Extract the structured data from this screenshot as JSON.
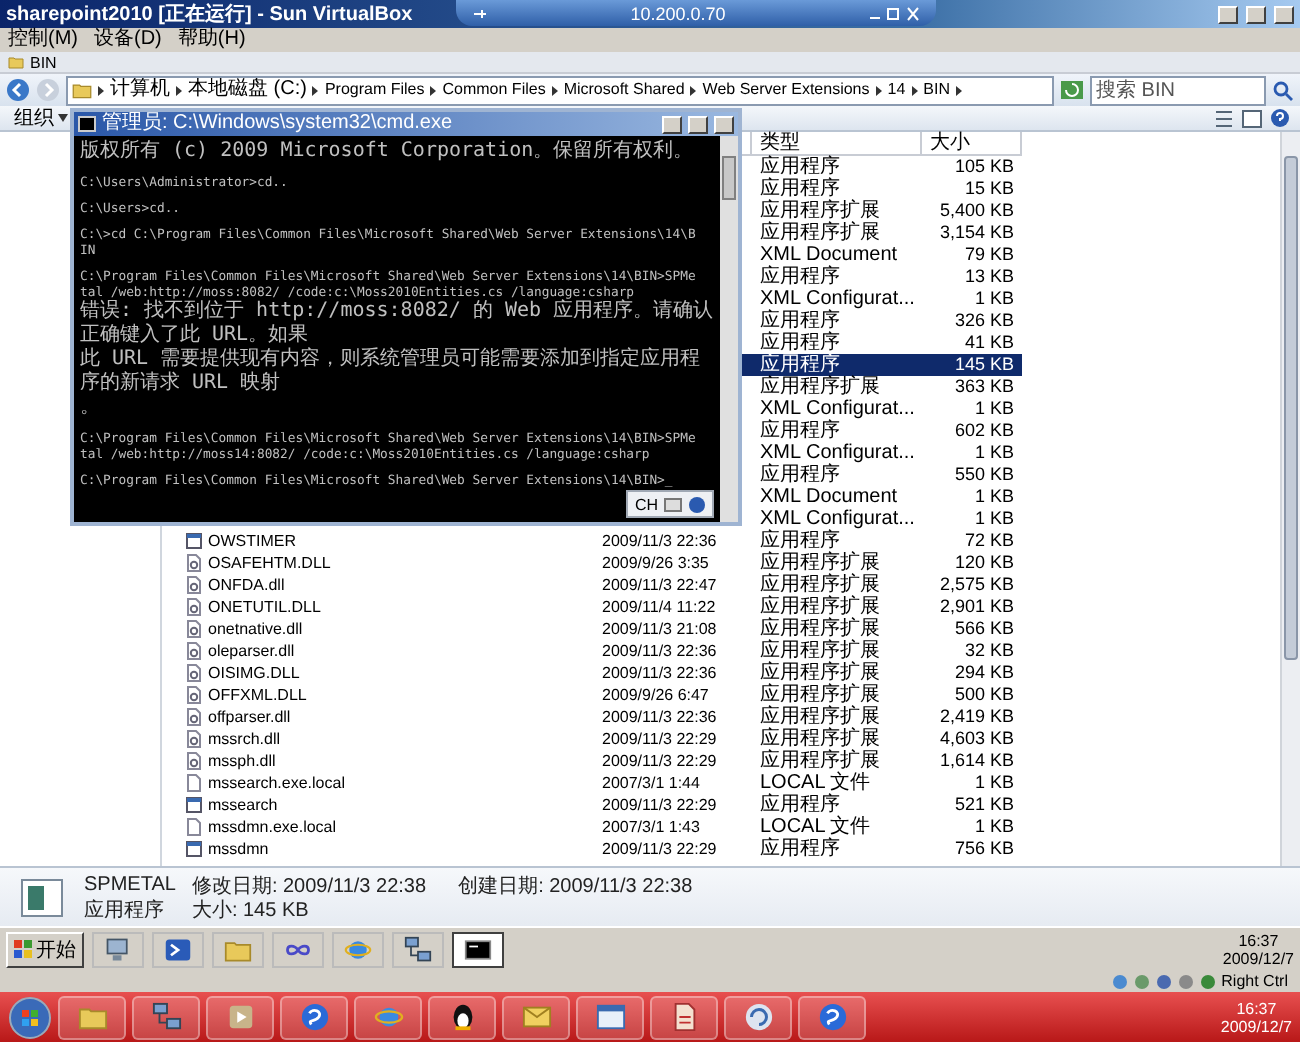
{
  "vm_window": {
    "title": "sharepoint2010 [正在运行] - Sun VirtualBox",
    "menu": [
      "控制(M)",
      "设备(D)",
      "帮助(H)"
    ]
  },
  "remote_bar": {
    "address": "10.200.0.70"
  },
  "explorer": {
    "title": "BIN",
    "breadcrumb": [
      {
        "label": "计算机",
        "kind": "system"
      },
      {
        "label": "本地磁盘 (C:)",
        "kind": "system"
      },
      {
        "label": "Program Files",
        "kind": "folder"
      },
      {
        "label": "Common Files",
        "kind": "folder"
      },
      {
        "label": "Microsoft Shared",
        "kind": "folder"
      },
      {
        "label": "Web Server Extensions",
        "kind": "folder"
      },
      {
        "label": "14",
        "kind": "folder"
      },
      {
        "label": "BIN",
        "kind": "folder"
      }
    ],
    "search": {
      "placeholder": "搜索 BIN"
    },
    "organize": "组织",
    "columns": [
      "类型",
      "大小"
    ],
    "rows": [
      {
        "type": "应用程序",
        "size": "105 KB",
        "selected": false
      },
      {
        "type": "应用程序",
        "size": "15 KB",
        "selected": false
      },
      {
        "type": "应用程序扩展",
        "size": "5,400 KB",
        "selected": false
      },
      {
        "type": "应用程序扩展",
        "size": "3,154 KB",
        "selected": false
      },
      {
        "type": "XML Document",
        "size": "79 KB",
        "selected": false
      },
      {
        "type": "应用程序",
        "size": "13 KB",
        "selected": false
      },
      {
        "type": "XML Configurat...",
        "size": "1 KB",
        "selected": false
      },
      {
        "type": "应用程序",
        "size": "326 KB",
        "selected": false
      },
      {
        "type": "应用程序",
        "size": "41 KB",
        "selected": false
      },
      {
        "type": "应用程序",
        "size": "145 KB",
        "selected": true
      },
      {
        "type": "应用程序扩展",
        "size": "363 KB",
        "selected": false
      },
      {
        "type": "XML Configurat...",
        "size": "1 KB",
        "selected": false
      },
      {
        "type": "应用程序",
        "size": "602 KB",
        "selected": false
      },
      {
        "type": "XML Configurat...",
        "size": "1 KB",
        "selected": false
      },
      {
        "type": "应用程序",
        "size": "550 KB",
        "selected": false
      },
      {
        "type": "XML Document",
        "size": "1 KB",
        "selected": false
      },
      {
        "type": "XML Configurat...",
        "size": "1 KB",
        "selected": false
      },
      {
        "name": "OWSTIMER",
        "kind": "exe",
        "date": "2009/11/3 22:36",
        "type": "应用程序",
        "size": "72 KB",
        "selected": false
      },
      {
        "name": "OSAFEHTM.DLL",
        "kind": "dll",
        "date": "2009/9/26 3:35",
        "type": "应用程序扩展",
        "size": "120 KB",
        "selected": false
      },
      {
        "name": "ONFDA.dll",
        "kind": "dll",
        "date": "2009/11/3 22:47",
        "type": "应用程序扩展",
        "size": "2,575 KB",
        "selected": false
      },
      {
        "name": "ONETUTIL.DLL",
        "kind": "dll",
        "date": "2009/11/4 11:22",
        "type": "应用程序扩展",
        "size": "2,901 KB",
        "selected": false
      },
      {
        "name": "onetnative.dll",
        "kind": "dll",
        "date": "2009/11/3 21:08",
        "type": "应用程序扩展",
        "size": "566 KB",
        "selected": false
      },
      {
        "name": "oleparser.dll",
        "kind": "dll",
        "date": "2009/11/3 22:36",
        "type": "应用程序扩展",
        "size": "32 KB",
        "selected": false
      },
      {
        "name": "OISIMG.DLL",
        "kind": "dll",
        "date": "2009/11/3 22:36",
        "type": "应用程序扩展",
        "size": "294 KB",
        "selected": false
      },
      {
        "name": "OFFXML.DLL",
        "kind": "dll",
        "date": "2009/9/26 6:47",
        "type": "应用程序扩展",
        "size": "500 KB",
        "selected": false
      },
      {
        "name": "offparser.dll",
        "kind": "dll",
        "date": "2009/11/3 22:36",
        "type": "应用程序扩展",
        "size": "2,419 KB",
        "selected": false
      },
      {
        "name": "mssrch.dll",
        "kind": "dll",
        "date": "2009/11/3 22:29",
        "type": "应用程序扩展",
        "size": "4,603 KB",
        "selected": false
      },
      {
        "name": "mssph.dll",
        "kind": "dll",
        "date": "2009/11/3 22:29",
        "type": "应用程序扩展",
        "size": "1,614 KB",
        "selected": false
      },
      {
        "name": "mssearch.exe.local",
        "kind": "file",
        "date": "2007/3/1 1:44",
        "type": "LOCAL 文件",
        "size": "1 KB",
        "selected": false
      },
      {
        "name": "mssearch",
        "kind": "exe",
        "date": "2009/11/3 22:29",
        "type": "应用程序",
        "size": "521 KB",
        "selected": false
      },
      {
        "name": "mssdmn.exe.local",
        "kind": "file",
        "date": "2007/3/1 1:43",
        "type": "LOCAL 文件",
        "size": "1 KB",
        "selected": false
      },
      {
        "name": "mssdmn",
        "kind": "exe",
        "date": "2009/11/3 22:29",
        "type": "应用程序",
        "size": "756 KB",
        "selected": false
      }
    ]
  },
  "details": {
    "name": "SPMETAL",
    "type": "应用程序",
    "fields": [
      {
        "label": "修改日期:",
        "value": "2009/11/3 22:38"
      },
      {
        "label": "创建日期:",
        "value": "2009/11/3 22:38"
      },
      {
        "label": "大小:",
        "value": "145 KB"
      }
    ]
  },
  "cmd": {
    "title": "管理员: C:\\Windows\\system32\\cmd.exe",
    "blocks": [
      {
        "lines": [
          {
            "kind": "output",
            "text": "版权所有 (c) 2009 Microsoft Corporation。保留所有权利。"
          }
        ]
      },
      {
        "lines": [
          {
            "kind": "prompt",
            "text": "C:\\Users\\Administrator>cd.."
          }
        ]
      },
      {
        "lines": [
          {
            "kind": "prompt",
            "text": "C:\\Users>cd.."
          }
        ]
      },
      {
        "lines": [
          {
            "kind": "prompt",
            "text": "C:\\>cd C:\\Program Files\\Common Files\\Microsoft Shared\\Web Server Extensions\\14\\B"
          },
          {
            "kind": "prompt",
            "text": "IN"
          }
        ]
      },
      {
        "lines": [
          {
            "kind": "prompt",
            "text": "C:\\Program Files\\Common Files\\Microsoft Shared\\Web Server Extensions\\14\\BIN>SPMe"
          },
          {
            "kind": "prompt",
            "text": "tal /web:http://moss:8082/ /code:c:\\Moss2010Entities.cs /language:csharp"
          },
          {
            "kind": "output",
            "text": "错误: 找不到位于 http://moss:8082/ 的 Web 应用程序。请确认正确键入了此 URL。如果"
          },
          {
            "kind": "output",
            "text": "此 URL 需要提供现有内容，则系统管理员可能需要添加到指定应用程序的新请求 URL 映射"
          },
          {
            "kind": "output",
            "text": "。"
          }
        ]
      },
      {
        "lines": [
          {
            "kind": "prompt",
            "text": "C:\\Program Files\\Common Files\\Microsoft Shared\\Web Server Extensions\\14\\BIN>SPMe"
          },
          {
            "kind": "prompt",
            "text": "tal /web:http://moss14:8082/ /code:c:\\Moss2010Entities.cs /language:csharp"
          }
        ]
      },
      {
        "lines": [
          {
            "kind": "prompt",
            "text": "C:\\Program Files\\Common Files\\Microsoft Shared\\Web Server Extensions\\14\\BIN>_"
          }
        ]
      }
    ],
    "ime": "CH"
  },
  "guest_taskbar": {
    "start": "开始",
    "tasks": [
      {
        "kind": "server",
        "selected": false
      },
      {
        "kind": "shell",
        "selected": false
      },
      {
        "kind": "folder",
        "selected": false
      },
      {
        "kind": "infinity",
        "selected": false
      },
      {
        "kind": "ie",
        "selected": false
      },
      {
        "kind": "network",
        "selected": false
      },
      {
        "kind": "console",
        "selected": true
      }
    ],
    "time": "16:37",
    "date": "2009/12/7"
  },
  "vbox_status": {
    "host_key": "Right Ctrl"
  },
  "host_taskbar": {
    "apps": [
      {
        "kind": "folder"
      },
      {
        "kind": "network"
      },
      {
        "kind": "media"
      },
      {
        "kind": "sphere"
      },
      {
        "kind": "ie"
      },
      {
        "kind": "penguin"
      },
      {
        "kind": "mail"
      },
      {
        "kind": "window"
      },
      {
        "kind": "document"
      },
      {
        "kind": "recycle"
      },
      {
        "kind": "sphere"
      }
    ],
    "time": "16:37",
    "date": "2009/12/7"
  }
}
